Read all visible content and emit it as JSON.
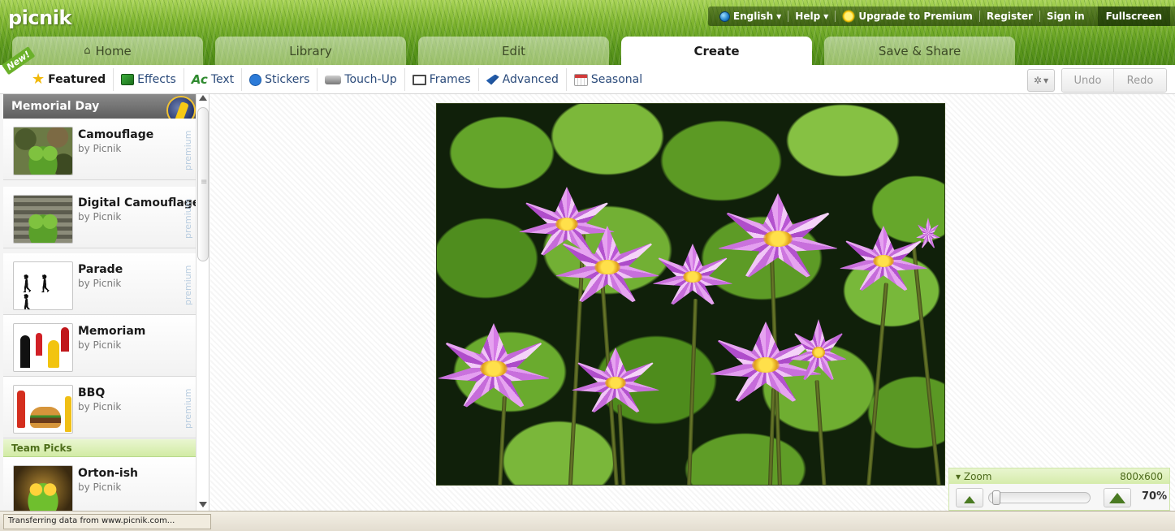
{
  "header": {
    "logo": "picnik",
    "nav": {
      "language": "English",
      "help": "Help",
      "upgrade": "Upgrade to Premium",
      "register": "Register",
      "sign_in": "Sign in",
      "fullscreen": "Fullscreen"
    }
  },
  "tabs": [
    {
      "label": "Home",
      "icon": "home-icon"
    },
    {
      "label": "Library"
    },
    {
      "label": "Edit"
    },
    {
      "label": "Create",
      "active": true
    },
    {
      "label": "Save & Share"
    }
  ],
  "toolbar": {
    "new_badge": "New!",
    "subtabs": [
      {
        "label": "Featured",
        "icon": "star-icon",
        "active": true
      },
      {
        "label": "Effects",
        "icon": "effects-icon"
      },
      {
        "label": "Text",
        "icon": "text-icon"
      },
      {
        "label": "Stickers",
        "icon": "stickers-icon"
      },
      {
        "label": "Touch-Up",
        "icon": "touchup-icon"
      },
      {
        "label": "Frames",
        "icon": "frames-icon"
      },
      {
        "label": "Advanced",
        "icon": "advanced-icon"
      },
      {
        "label": "Seasonal",
        "icon": "seasonal-icon"
      }
    ],
    "gear_icon": "gear-icon",
    "undo": "Undo",
    "redo": "Redo"
  },
  "sidebar": {
    "section_title": "Memorial Day",
    "items": [
      {
        "title": "Camouflage",
        "author": "by Picnik",
        "premium": "premium"
      },
      {
        "title": "Digital Camouflage",
        "author": "by Picnik",
        "premium": "premium"
      },
      {
        "title": "Parade",
        "author": "by Picnik",
        "premium": "premium"
      },
      {
        "title": "Memoriam",
        "author": "by Picnik"
      },
      {
        "title": "BBQ",
        "author": "by Picnik",
        "premium": "premium"
      }
    ],
    "team_picks_title": "Team Picks",
    "team_picks_items": [
      {
        "title": "Orton-ish",
        "author": "by Picnik"
      }
    ]
  },
  "zoom": {
    "label": "Zoom",
    "dimensions": "800x600",
    "percent": "70%",
    "level": 0.02
  },
  "status": {
    "text": "Transferring data from www.picnik.com..."
  },
  "colors": {
    "grass": "#6aa52a",
    "tab_active": "#ffffff",
    "link_blue": "#2a4a7a",
    "team_picks_bg": "#d2eba5"
  }
}
